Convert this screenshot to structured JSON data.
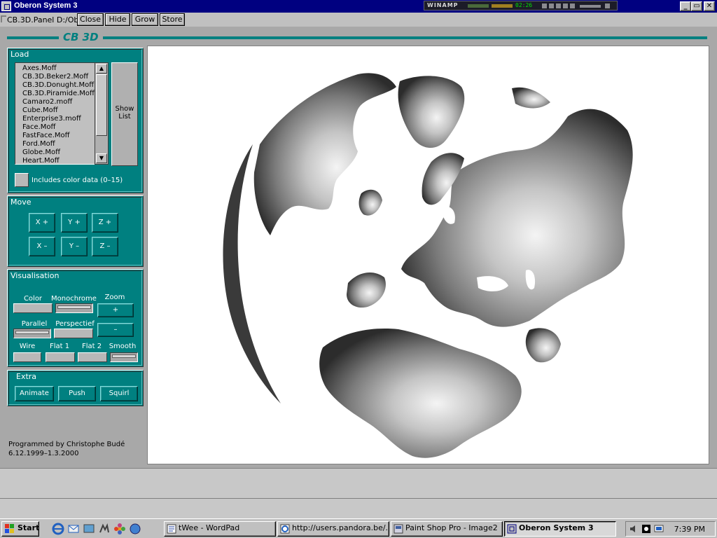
{
  "window": {
    "title": "Oberon System 3",
    "controls": [
      "_",
      "▭",
      "✕"
    ]
  },
  "winamp": {
    "label": "WINAMP",
    "time": "02:26"
  },
  "viewer": {
    "name": "CB.3D.Panel D:/Obe",
    "buttons": [
      "Close",
      "Hide",
      "Grow",
      "Store"
    ]
  },
  "panel": {
    "title": "CB 3D",
    "load": {
      "title": "Load",
      "files": [
        "Axes.Moff",
        "CB.3D.Beker2.Moff",
        "CB.3D.Donught.Moff",
        "CB.3D.Piramide.Moff",
        "Camaro2.moff",
        "Cube.Moff",
        "Enterprise3.moff",
        "Face.Moff",
        "FastFace.Moff",
        "Ford.Moff",
        "Globe.Moff",
        "Heart.Moff"
      ],
      "show_list_line1": "Show",
      "show_list_line2": "List",
      "color_data_label": "Includes color data (0–15)"
    },
    "move": {
      "title": "Move",
      "buttons": [
        "X +",
        "Y +",
        "Z +",
        "X –",
        "Y –",
        "Z –"
      ]
    },
    "visualisation": {
      "title": "Visualisation",
      "color": "Color",
      "monochrome": "Monochrome",
      "zoom": "Zoom",
      "zoom_in": "+",
      "zoom_out": "–",
      "parallel": "Parallel",
      "perspectief": "Perspectief",
      "wire": "Wire",
      "flat1": "Flat 1",
      "flat2": "Flat 2",
      "smooth": "Smooth"
    },
    "extra": {
      "title": "Extra",
      "buttons": [
        "Animate",
        "Push",
        "Squirl"
      ]
    },
    "credit_line1": "Programmed by  Christophe Budé",
    "credit_line2": "6.12.1999–1.3.2000"
  },
  "taskbar": {
    "start": "Start",
    "tasks": [
      "tWee - WordPad",
      "http://users.pandora.be/...",
      "Paint Shop Pro - Image2",
      "Oberon System 3"
    ],
    "clock": "7:39 PM"
  }
}
